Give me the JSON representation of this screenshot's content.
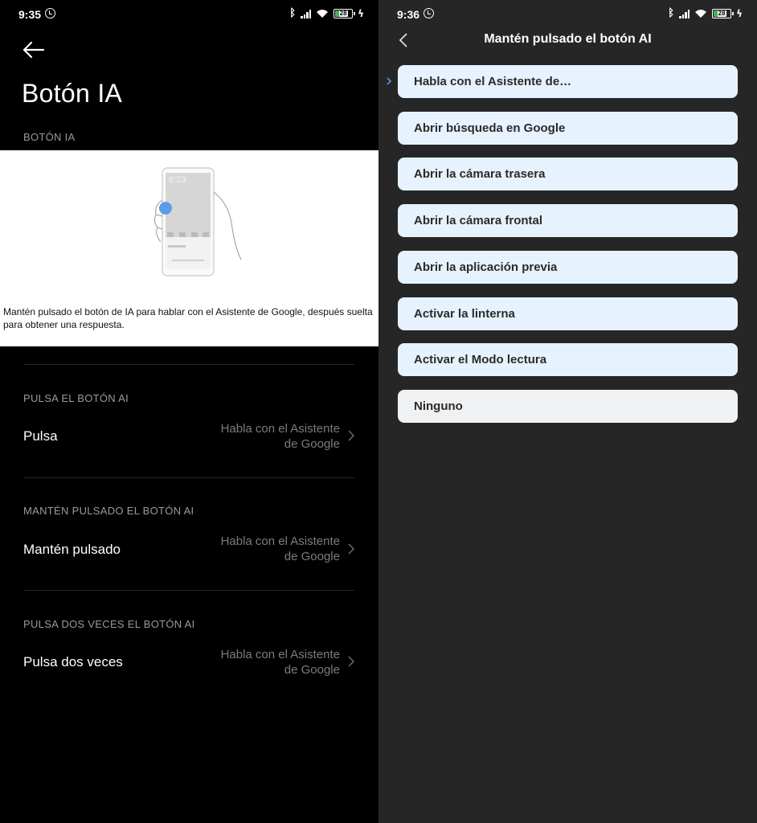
{
  "left": {
    "status": {
      "time": "9:35",
      "battery": "28"
    },
    "title": "Botón IA",
    "section_label": "BOTÓN IA",
    "hero": {
      "illus_time": "6:23",
      "description": "Mantén pulsado el botón de IA para hablar con el Asistente de Google, después suelta para obtener una respuesta."
    },
    "settings": [
      {
        "section": "PULSA EL BOTÓN AI",
        "title": "Pulsa",
        "value_line1": "Habla con el Asistente",
        "value_line2": "de Google"
      },
      {
        "section": "MANTÉN PULSADO EL BOTÓN AI",
        "title": "Mantén pulsado",
        "value_line1": "Habla con el Asistente",
        "value_line2": "de Google"
      },
      {
        "section": "PULSA DOS VECES EL BOTÓN AI",
        "title": "Pulsa dos veces",
        "value_line1": "Habla con el Asistente",
        "value_line2": "de Google"
      }
    ]
  },
  "right": {
    "status": {
      "time": "9:36",
      "battery": "28"
    },
    "header_title": "Mantén pulsado el botón AI",
    "options": [
      {
        "label": "Habla con el Asistente de…"
      },
      {
        "label": "Abrir búsqueda en Google"
      },
      {
        "label": "Abrir la cámara trasera"
      },
      {
        "label": "Abrir la cámara frontal"
      },
      {
        "label": "Abrir la aplicación previa"
      },
      {
        "label": "Activar la linterna"
      },
      {
        "label": "Activar el Modo lectura"
      },
      {
        "label": "Ninguno"
      }
    ],
    "selected_index": 0
  },
  "colors": {
    "left_bg": "#000000",
    "right_bg": "#262626",
    "option_bg": "#e6f2fd",
    "option_plain_bg": "#f0f1f2",
    "accent": "#4a90e2",
    "battery_fill": "#4caf50"
  },
  "icons": [
    "back-arrow-icon",
    "chevron-right-icon",
    "alarm-icon",
    "bluetooth-icon",
    "signal-icon",
    "wifi-icon",
    "battery-icon",
    "charging-icon"
  ]
}
